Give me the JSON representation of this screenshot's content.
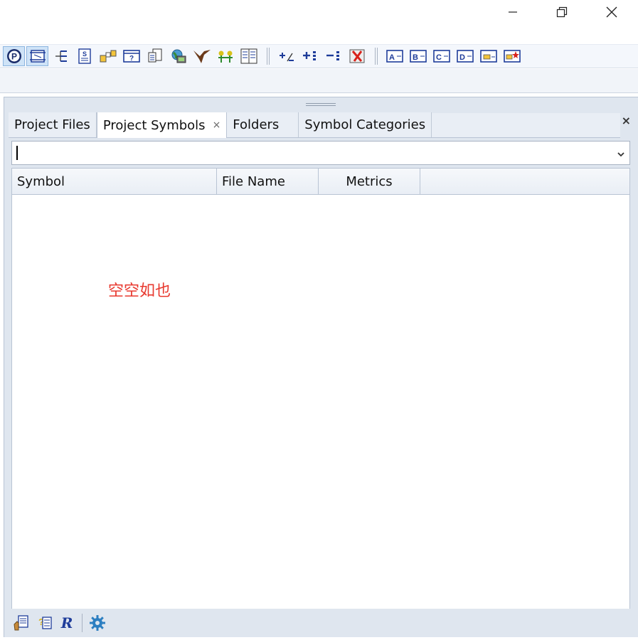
{
  "window": {
    "controls": [
      "minimize-icon",
      "restore-icon",
      "close-icon"
    ]
  },
  "toolbar": {
    "groups": [
      [
        "project-symbol-icon",
        "symbol-window-icon",
        "relation-tree-icon",
        "source-file-icon",
        "folder-structure-icon",
        "help-context-icon",
        "file-compare-icon",
        "browse-web-icon",
        "bird-icon",
        "merge-icon",
        "split-view-icon"
      ],
      [
        "expand-collapse-icon",
        "expand-all-icon",
        "collapse-all-icon",
        "delete-red-x-icon"
      ],
      [
        "bookmark-a-icon",
        "bookmark-b-icon",
        "bookmark-c-icon",
        "bookmark-d-icon",
        "bookmark-folder-icon",
        "bookmark-new-icon"
      ]
    ]
  },
  "panel": {
    "tabs": [
      {
        "label": "Project Files",
        "selected": false
      },
      {
        "label": "Project Symbols",
        "selected": true,
        "close": "×"
      },
      {
        "label": "Folders",
        "selected": false
      },
      {
        "label": "Symbol Categories",
        "selected": false
      }
    ],
    "close_label": "×",
    "filter": {
      "value": "",
      "placeholder": ""
    },
    "columns": [
      "Symbol",
      "File Name",
      "Metrics"
    ],
    "rows": [],
    "empty_note": "空空如也"
  },
  "bottombar": {
    "buttons": [
      "hand-properties-icon",
      "help-list-icon",
      "regex-r-icon",
      "settings-gear-icon"
    ]
  },
  "colors": {
    "empty_note": "#e8392f",
    "toolbar_active": "#cfe3f7",
    "panel_bg": "#dfe6ef",
    "icon_blue": "#1e3c9a"
  }
}
